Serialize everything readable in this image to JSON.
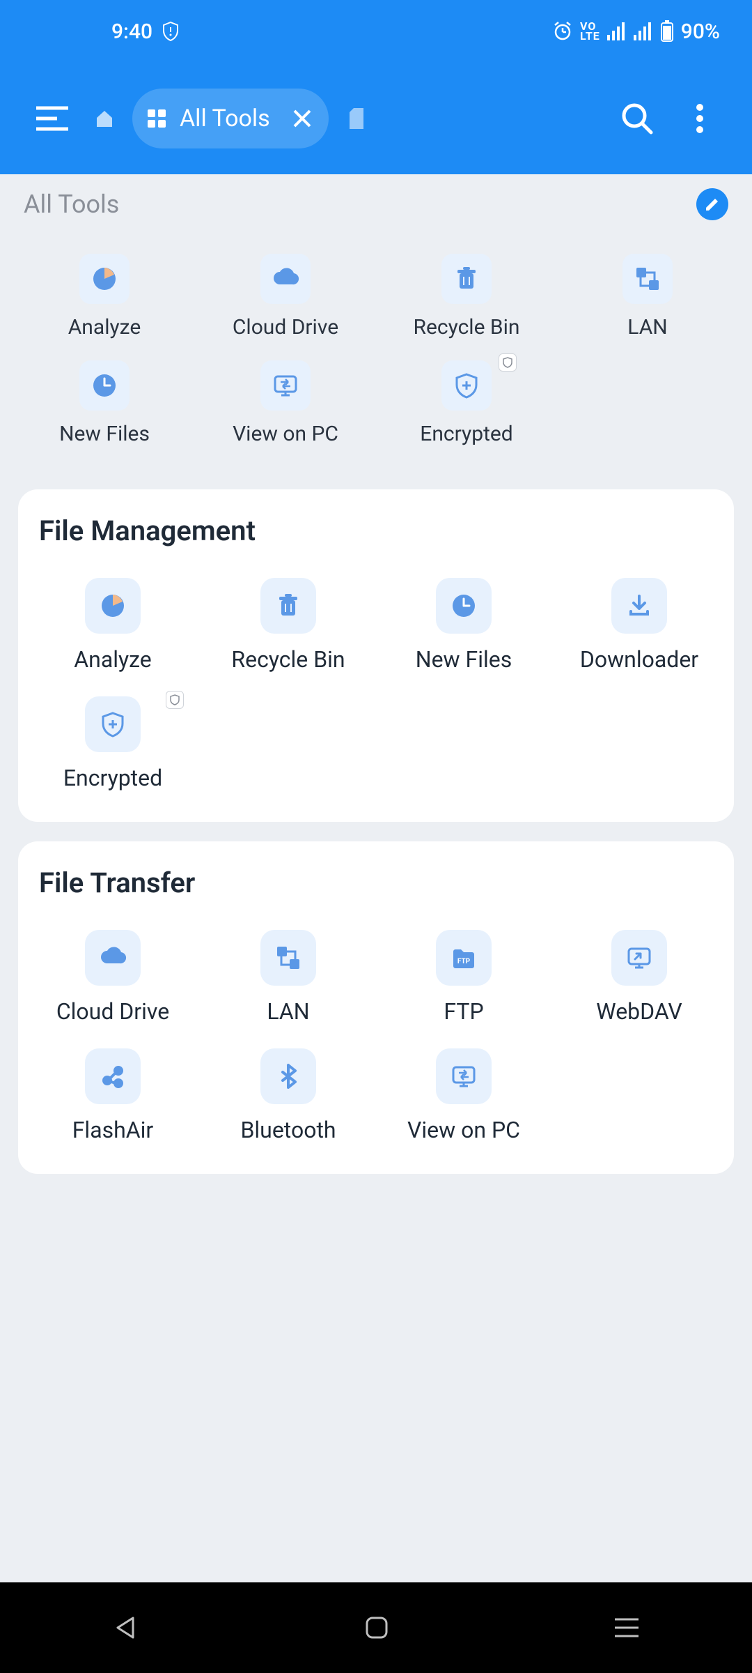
{
  "status": {
    "time": "9:40",
    "battery": "90%"
  },
  "appbar": {
    "tab_label": "All Tools"
  },
  "quick_title": "All Tools",
  "quick": [
    {
      "label": "Analyze",
      "icon": "pie-chart-icon"
    },
    {
      "label": "Cloud Drive",
      "icon": "cloud-icon"
    },
    {
      "label": "Recycle Bin",
      "icon": "trash-icon"
    },
    {
      "label": "LAN",
      "icon": "lan-icon"
    },
    {
      "label": "New Files",
      "icon": "clock-icon"
    },
    {
      "label": "View on PC",
      "icon": "monitor-transfer-icon"
    },
    {
      "label": "Encrypted",
      "icon": "shield-plus-icon",
      "badge": true
    }
  ],
  "sections": [
    {
      "title": "File Management",
      "items": [
        {
          "label": "Analyze",
          "icon": "pie-chart-icon"
        },
        {
          "label": "Recycle Bin",
          "icon": "trash-icon"
        },
        {
          "label": "New Files",
          "icon": "clock-icon"
        },
        {
          "label": "Downloader",
          "icon": "download-icon"
        },
        {
          "label": "Encrypted",
          "icon": "shield-plus-icon",
          "badge": true
        }
      ]
    },
    {
      "title": "File Transfer",
      "items": [
        {
          "label": "Cloud Drive",
          "icon": "cloud-icon"
        },
        {
          "label": "LAN",
          "icon": "lan-icon"
        },
        {
          "label": "FTP",
          "icon": "ftp-folder-icon"
        },
        {
          "label": "WebDAV",
          "icon": "webdav-icon"
        },
        {
          "label": "FlashAir",
          "icon": "flashair-icon"
        },
        {
          "label": "Bluetooth",
          "icon": "bluetooth-icon"
        },
        {
          "label": "View on PC",
          "icon": "monitor-transfer-icon"
        }
      ]
    }
  ]
}
